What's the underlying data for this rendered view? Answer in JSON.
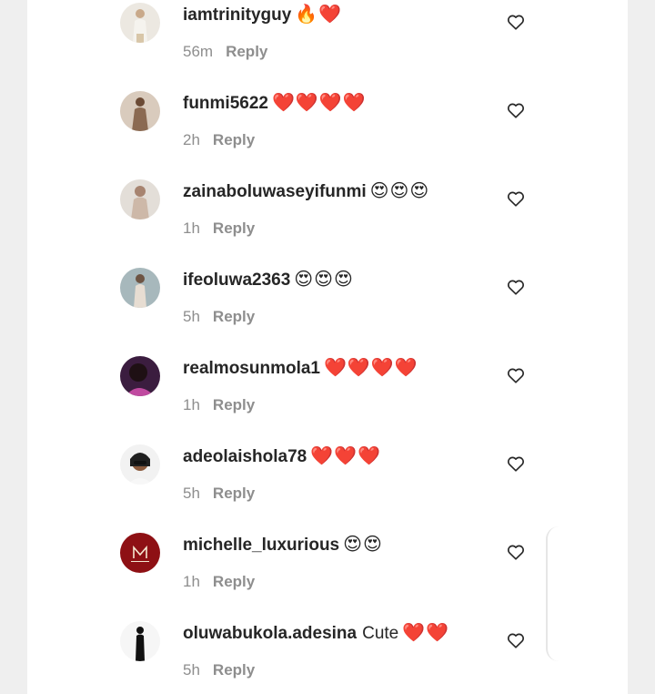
{
  "comments": [
    {
      "username": "iamtrinityguy",
      "text": "",
      "emojis": "🔥❤️",
      "time": "56m",
      "reply": "Reply",
      "avatar_colors": [
        "#e9e4dc",
        "#d8c6a8"
      ]
    },
    {
      "username": "funmi5622",
      "text": "",
      "emojis": "❤️❤️❤️❤️",
      "time": "2h",
      "reply": "Reply",
      "avatar_colors": [
        "#c9b7a3",
        "#7a5a43"
      ]
    },
    {
      "username": "zainaboluwaseyifunmi",
      "text": "",
      "emojis": "😍😍😍",
      "time": "1h",
      "reply": "Reply",
      "avatar_colors": [
        "#d9d4cf",
        "#b19583"
      ]
    },
    {
      "username": "ifeoluwa2363",
      "text": "",
      "emojis": "😍😍😍",
      "time": "5h",
      "reply": "Reply",
      "avatar_colors": [
        "#8fa3a9",
        "#e1d7cc"
      ]
    },
    {
      "username": "realmosunmola1",
      "text": "",
      "emojis": "❤️❤️❤️❤️",
      "time": "1h",
      "reply": "Reply",
      "avatar_colors": [
        "#3b1d3f",
        "#c04aa0"
      ]
    },
    {
      "username": "adeolaishola78",
      "text": "",
      "emojis": "❤️❤️❤️",
      "time": "5h",
      "reply": "Reply",
      "avatar_colors": [
        "#f2f2f2",
        "#1f1f1f"
      ]
    },
    {
      "username": "michelle_luxurious",
      "text": "",
      "emojis": "😍😍",
      "time": "1h",
      "reply": "Reply",
      "avatar_colors": [
        "#8e1014",
        "#f4e7d0"
      ]
    },
    {
      "username": "oluwabukola.adesina",
      "text": "Cute",
      "emojis": "❤️❤️",
      "time": "5h",
      "reply": "Reply",
      "avatar_colors": [
        "#f6f6f6",
        "#111111"
      ]
    }
  ],
  "icons": {
    "like": "heart-outline-icon"
  },
  "colors": {
    "username": "#262626",
    "meta": "#8e8e8e",
    "background": "#efefef",
    "panel": "#ffffff"
  }
}
